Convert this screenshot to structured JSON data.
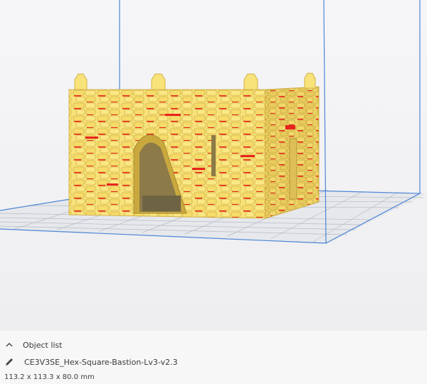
{
  "object_list": {
    "header_label": "Object list",
    "toggle_icon": "chevron-up-icon"
  },
  "object": {
    "name": "CE3V3SE_Hex-Square-Bastion-Lv3-v2.3",
    "edit_icon": "pencil-icon",
    "dimensions": "113.2 x 113.3 x 80.0 mm"
  },
  "colors": {
    "model_fill": "#f8e27a",
    "model_shadow": "#d9b94a",
    "overhang_red": "#e8241e",
    "build_volume_edge": "#4d86d6",
    "build_plate_grid": "#b8bcc4",
    "build_plate_fill": "#e6e8ec"
  }
}
